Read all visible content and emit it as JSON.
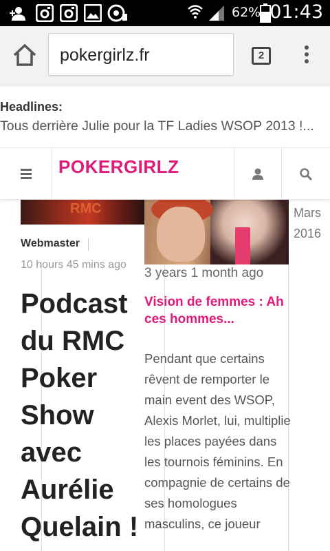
{
  "status_bar": {
    "battery_percent": "62%",
    "time": "01:43",
    "icons": [
      "person-add-icon",
      "instagram-icon",
      "instagram-icon",
      "image-icon",
      "media-icon",
      "wifi-icon",
      "signal-icon",
      "battery-icon"
    ]
  },
  "browser": {
    "url": "pokergirlz.fr",
    "tab_count": "2"
  },
  "headlines": {
    "label": "Headlines:",
    "text": "Tous derrière Julie pour la TF Ladies WSOP 2013 !..."
  },
  "site": {
    "logo": "POKERGIRLZ"
  },
  "articles": {
    "first": {
      "author": "Webmaster",
      "time": "10 hours 45 mins ago",
      "title": "Podcast du RMC Poker Show avec Aurélie Quelain !",
      "image_text": "RMC"
    },
    "second": {
      "time": "3 years 1 month ago",
      "title": "Vision de femmes : Ah ces hommes...",
      "excerpt": "Pendant que certains rêvent de remporter le main event des WSOP, Alexis Morlet, lui, multiplie les places payées dans les tournois féminins. En compagnie de certains de ses homologues masculins, ce joueur"
    },
    "third": {
      "date": "Mars 2016"
    }
  },
  "colors": {
    "brand_pink": "#e01a7a",
    "status_bar": "#000000",
    "toolbar": "#f2f2f2"
  }
}
